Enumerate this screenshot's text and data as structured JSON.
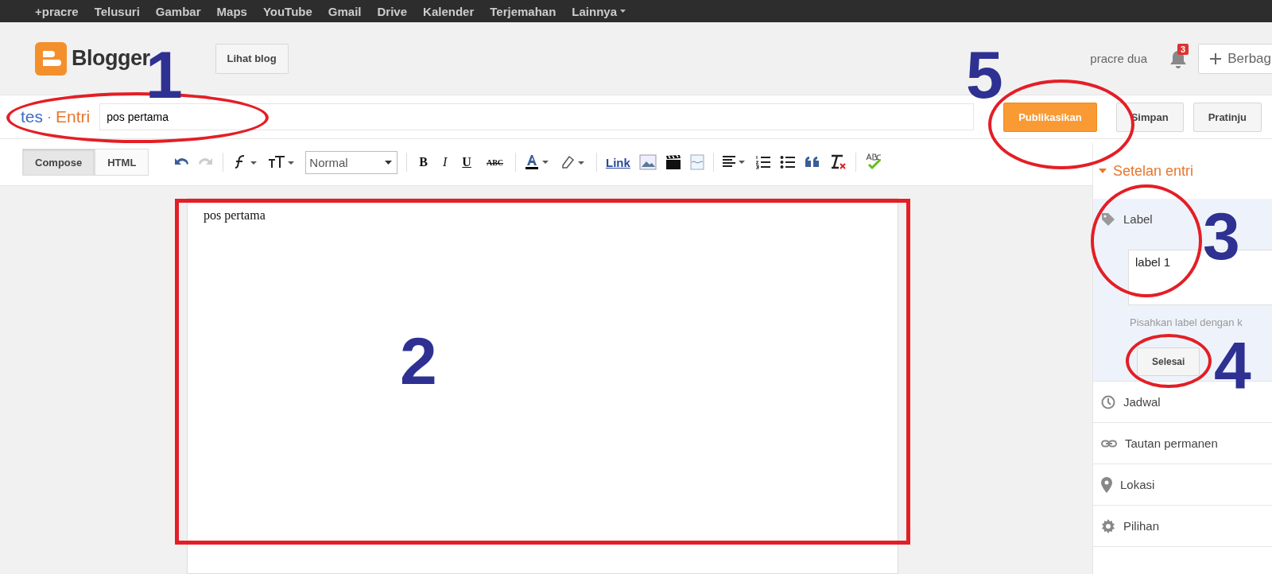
{
  "top_bar": {
    "links": [
      {
        "label": "+pracre",
        "dropdown": false
      },
      {
        "label": "Telusuri",
        "dropdown": false
      },
      {
        "label": "Gambar",
        "dropdown": false
      },
      {
        "label": "Maps",
        "dropdown": false
      },
      {
        "label": "YouTube",
        "dropdown": false
      },
      {
        "label": "Gmail",
        "dropdown": false
      },
      {
        "label": "Drive",
        "dropdown": false
      },
      {
        "label": "Kalender",
        "dropdown": false
      },
      {
        "label": "Terjemahan",
        "dropdown": false
      },
      {
        "label": "Lainnya",
        "dropdown": true
      }
    ]
  },
  "header": {
    "logo_text": "Blogger",
    "view_blog_button": "Lihat blog",
    "user_name": "pracre dua",
    "notification_count": "3",
    "share_button": "Berbag"
  },
  "post_bar": {
    "blog_name": "tes",
    "separator": "·",
    "section": "Entri",
    "title_field": {
      "value": "pos pertama"
    },
    "buttons": [
      {
        "label": "Publikasikan",
        "kind": "primary"
      },
      {
        "label": "Simpan",
        "kind": "normal"
      },
      {
        "label": "Pratinju",
        "kind": "normal"
      }
    ]
  },
  "toolbar": {
    "modes": [
      {
        "label": "Compose",
        "selected": true
      },
      {
        "label": "HTML",
        "selected": false
      }
    ],
    "paragraph_style": "Normal",
    "format_buttons": [
      "B",
      "I",
      "U",
      "ABC"
    ],
    "link": "Link"
  },
  "editor": {
    "body": "pos pertama"
  },
  "sidebar": {
    "title": "Setelan entri",
    "expanded": true,
    "sections": [
      {
        "label": "Label",
        "kind": "labels",
        "expanded": true,
        "field_value": "label 1",
        "hint": "Pisahkan label dengan k",
        "button": "Selesai"
      },
      {
        "label": "Jadwal",
        "kind": "item"
      },
      {
        "label": "Tautan permanen",
        "kind": "item"
      },
      {
        "label": "Lokasi",
        "kind": "item"
      },
      {
        "label": "Pilihan",
        "kind": "item"
      }
    ]
  },
  "annotations": [
    {
      "label": "1"
    },
    {
      "label": "2"
    },
    {
      "label": "3"
    },
    {
      "label": "4"
    },
    {
      "label": "5"
    }
  ]
}
